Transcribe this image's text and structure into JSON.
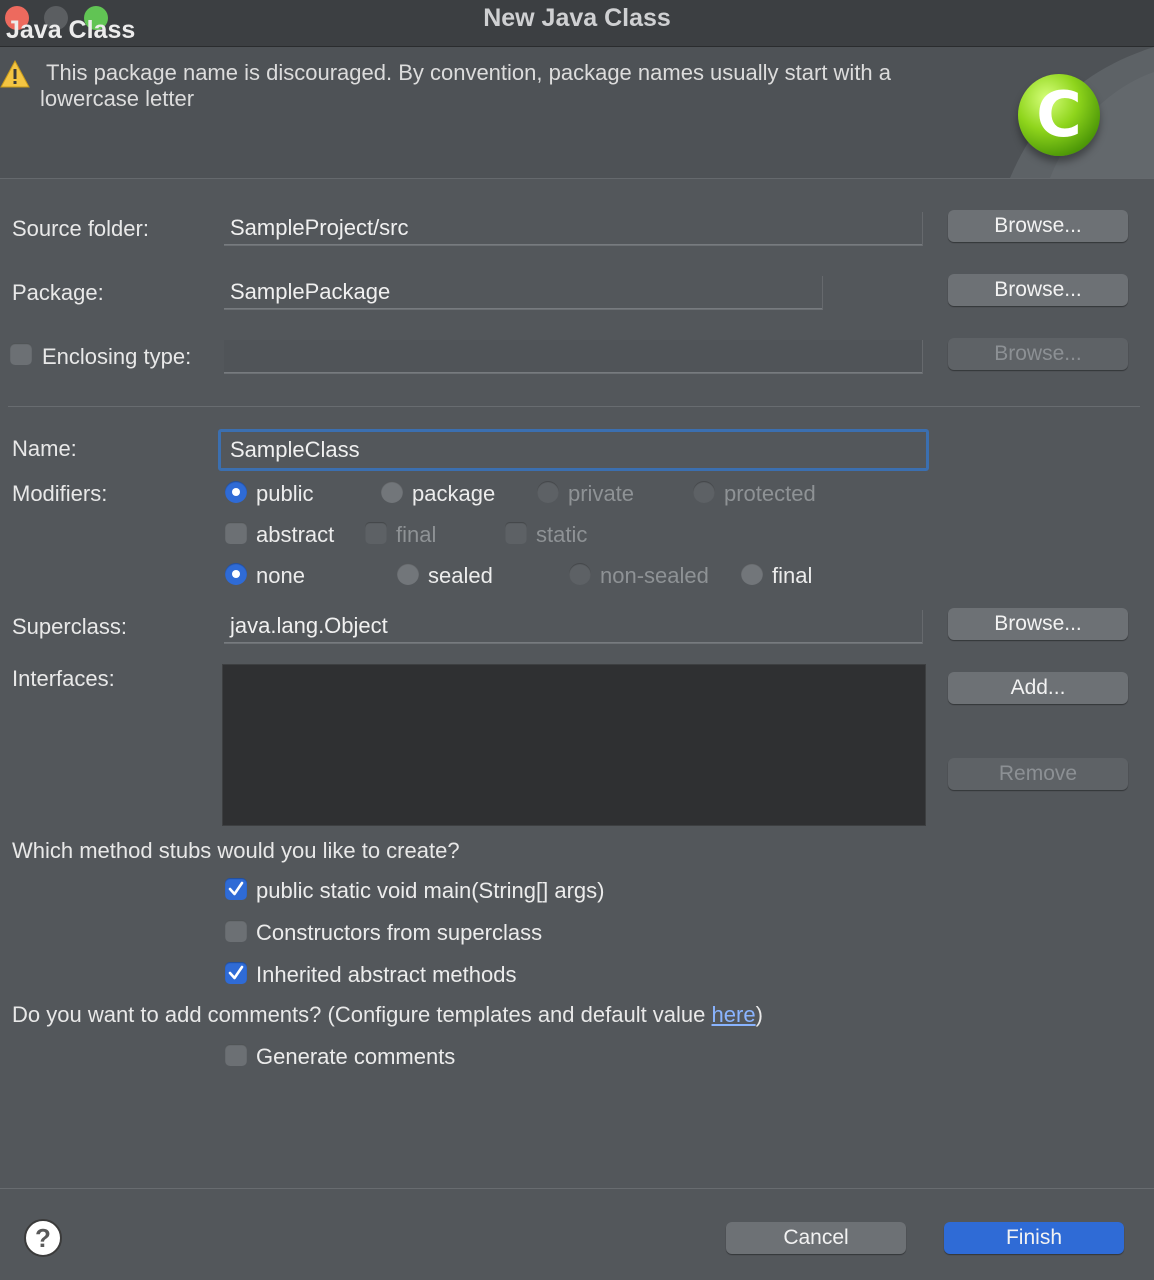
{
  "window": {
    "title": "New Java Class"
  },
  "header": {
    "title": "Java Class",
    "warning": "This package name is discouraged. By convention, package names usually start with a lowercase letter"
  },
  "form": {
    "source_folder": {
      "label": "Source folder:",
      "value": "SampleProject/src"
    },
    "package": {
      "label": "Package:",
      "value": "SamplePackage"
    },
    "enclosing_type": {
      "label": "Enclosing type:",
      "value": ""
    },
    "name": {
      "label": "Name:",
      "value": "SampleClass"
    },
    "modifiers": {
      "label": "Modifiers:",
      "access": [
        "public",
        "package",
        "private",
        "protected"
      ],
      "flags": [
        "abstract",
        "final",
        "static"
      ],
      "sealing": [
        "none",
        "sealed",
        "non-sealed",
        "final"
      ]
    },
    "superclass": {
      "label": "Superclass:",
      "value": "java.lang.Object"
    },
    "interfaces": {
      "label": "Interfaces:"
    }
  },
  "buttons": {
    "browse": "Browse...",
    "add": "Add...",
    "remove": "Remove",
    "cancel": "Cancel",
    "finish": "Finish"
  },
  "stubs": {
    "question": "Which method stubs would you like to create?",
    "options": [
      "public static void main(String[] args)",
      "Constructors from superclass",
      "Inherited abstract methods"
    ]
  },
  "comments": {
    "question_prefix": "Do you want to add comments? (Configure templates and default value ",
    "link": "here",
    "question_suffix": ")",
    "option": "Generate comments"
  },
  "colors": {
    "accent": "#2f6bd6",
    "background": "#53575b",
    "link": "#8ab4ff"
  },
  "icons": {
    "warning": "warning-icon",
    "help": "help-icon",
    "logo": "java-class-logo-icon"
  },
  "logo_text": "C"
}
